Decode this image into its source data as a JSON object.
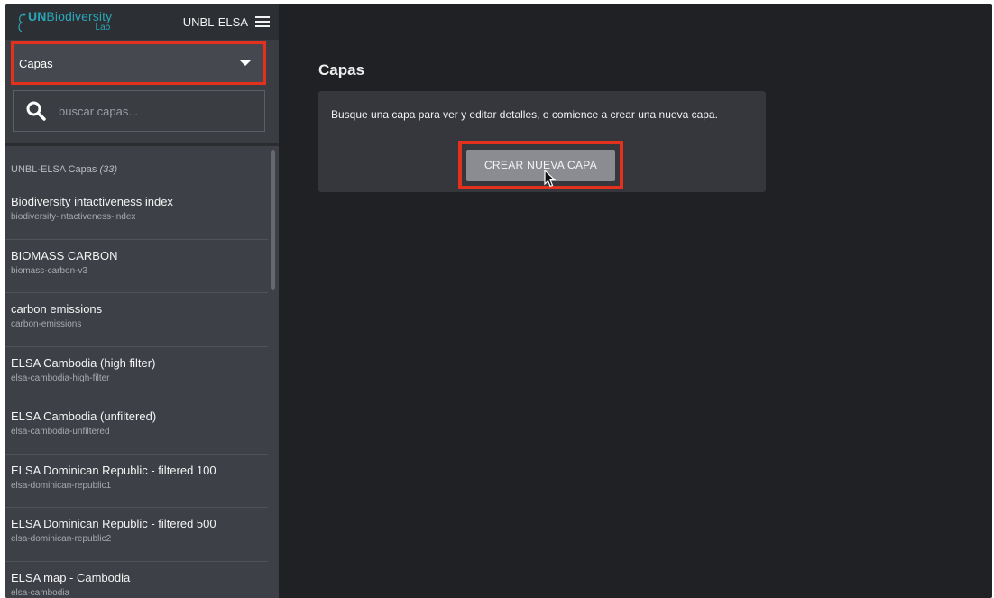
{
  "header": {
    "logo_line1_prefix": "UN",
    "logo_line1_rest": "Biodiversity",
    "logo_line2": "Lab",
    "workspace": "UNBL-ELSA"
  },
  "dropdown": {
    "value": "Capas"
  },
  "search": {
    "placeholder": "buscar capas..."
  },
  "list": {
    "heading": "UNBL-ELSA Capas",
    "count": "(33)",
    "items": [
      {
        "title": "Biodiversity intactiveness index",
        "slug": "biodiversity-intactiveness-index"
      },
      {
        "title": "BIOMASS CARBON",
        "slug": "biomass-carbon-v3"
      },
      {
        "title": "carbon emissions",
        "slug": "carbon-emissions"
      },
      {
        "title": "ELSA Cambodia (high filter)",
        "slug": "elsa-cambodia-high-filter"
      },
      {
        "title": "ELSA Cambodia (unfiltered)",
        "slug": "elsa-cambodia-unfiltered"
      },
      {
        "title": "ELSA Dominican Republic - filtered 100",
        "slug": "elsa-dominican-republic1"
      },
      {
        "title": "ELSA Dominican Republic - filtered 500",
        "slug": "elsa-dominican-republic2"
      },
      {
        "title": "ELSA map - Cambodia",
        "slug": "elsa-cambodia"
      }
    ]
  },
  "main": {
    "title": "Capas",
    "card_text": "Busque una capa para ver y editar detalles, o comience a crear una nueva capa.",
    "create_button": "CREAR NUEVA CAPA"
  },
  "colors": {
    "highlight": "#e3311d",
    "brand": "#2aa6b8",
    "background": "#202124",
    "sidebar": "#3a3d42"
  }
}
